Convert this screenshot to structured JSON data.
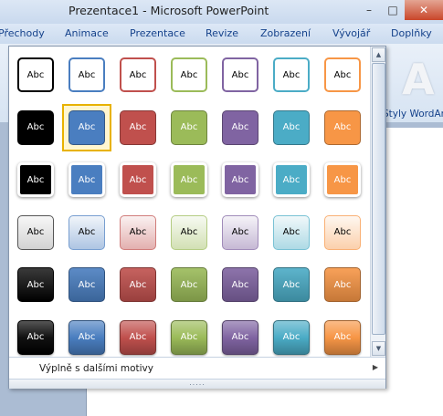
{
  "window": {
    "title": "Prezentace1  -  Microsoft PowerPoint",
    "minimize": "–",
    "maximize": "□",
    "close": "✕"
  },
  "ribbon": {
    "tabs": [
      "Přechody",
      "Animace",
      "Prezentace",
      "Revize",
      "Zobrazení",
      "Vývojář",
      "Doplňky"
    ],
    "wordart_glyph": "A",
    "wordart_group_label": "Styly WordArt"
  },
  "gallery": {
    "cell_label": "Abc",
    "selected": {
      "row": 1,
      "col": 1
    },
    "colors": [
      "#000000",
      "#4a7ec0",
      "#c0504d",
      "#9bbb59",
      "#8064a2",
      "#4bacc6",
      "#f79646"
    ],
    "rows": [
      {
        "style": "outline"
      },
      {
        "style": "solid"
      },
      {
        "style": "solid-light-border"
      },
      {
        "style": "pastel-gradient"
      },
      {
        "style": "gradient"
      },
      {
        "style": "glossy"
      }
    ],
    "scroll_up": "▲",
    "scroll_down": "▼",
    "more_fills": "Výplně s dalšími motivy",
    "more_fills_arrow": "▶",
    "grip": "....."
  }
}
